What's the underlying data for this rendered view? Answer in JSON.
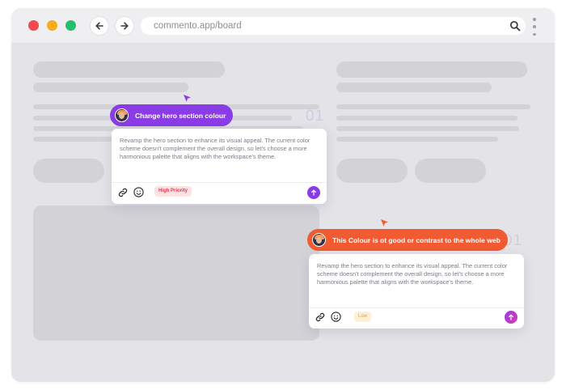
{
  "browser": {
    "url": "commento.app/board",
    "icons": {
      "back": "arrow-left-icon",
      "forward": "arrow-right-icon",
      "search": "search-icon",
      "menu": "kebab-menu-icon"
    },
    "traffic_lights": {
      "close": "#f04b4e",
      "minimize": "#f6ac1e",
      "maximize": "#26bd6b"
    }
  },
  "comments": [
    {
      "tag_label": "Change hero section colour",
      "tag_color": "#8a3ce6",
      "marker_number": "01",
      "body": "Revamp the hero section to enhance its visual appeal. The current color scheme doesn't complement the overall design, so let's choose a more harmonious palette that aligns with the workspace's theme.",
      "priority": "High Priority",
      "icons": [
        "link-icon",
        "emoji-icon",
        "send-arrow-icon"
      ]
    },
    {
      "tag_label": "This Colour is ot good or contrast to the whole web",
      "tag_color": "#f25a31",
      "marker_number": "01",
      "body": "Revamp the hero section to enhance its visual appeal. The current color scheme doesn't complement the overall design, so let's choose a more harmonious palette that aligns with the workspace's theme.",
      "priority": "Low",
      "icons": [
        "link-icon",
        "emoji-icon",
        "send-arrow-icon"
      ]
    }
  ]
}
